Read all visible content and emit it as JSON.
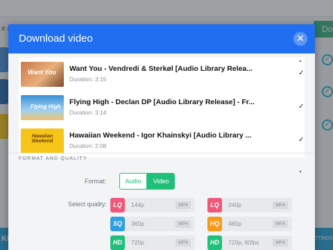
{
  "background": {
    "fragment_left": "e a v",
    "download_label": "Dow",
    "bottom_left_label": "KEE",
    "bottom_right_label": "TTINGS"
  },
  "modal": {
    "title": "Download video",
    "close_icon": "close-icon",
    "accent": "#1f6ff0"
  },
  "videos": [
    {
      "title": "Want You - Vendredi & Sterkøl [Audio Library Relea...",
      "duration": "Duration: 3:15",
      "thumb_text": "Want You",
      "checked": true
    },
    {
      "title": "Flying High - Declan DP [Audio Library Release] - Fr...",
      "duration": "Duration: 3:14",
      "thumb_text": "Flying High",
      "checked": true
    },
    {
      "title": "Hawaiian Weekend - Igor Khainskyi [Audio Library ...",
      "duration": "Duration: 2:08",
      "thumb_text": "Hawaiian Weekend",
      "checked": true
    }
  ],
  "format_quality": {
    "section_title": "FORMAT AND QUALITY",
    "format_label": "Format:",
    "formats": [
      "Audio",
      "Video"
    ],
    "selected_format": "Video",
    "quality_label": "Select quality:",
    "qualities": [
      {
        "badge": "LQ",
        "resolution": "144p",
        "container": "MP4",
        "color": "#f0587a"
      },
      {
        "badge": "LQ",
        "resolution": "240p",
        "container": "MP4",
        "color": "#f0587a"
      },
      {
        "badge": "SQ",
        "resolution": "360p",
        "container": "MP4",
        "color": "#2f9fe0"
      },
      {
        "badge": "HQ",
        "resolution": "480p",
        "container": "MP4",
        "color": "#f59a1b"
      },
      {
        "badge": "HD",
        "resolution": "720p",
        "container": "MP4",
        "color": "#21c07a"
      },
      {
        "badge": "HD",
        "resolution": "720p, 60fps",
        "container": "MP4",
        "color": "#21c07a"
      }
    ]
  },
  "colors": {
    "green": "#21c07a",
    "close_bg": "#5b97f6"
  }
}
